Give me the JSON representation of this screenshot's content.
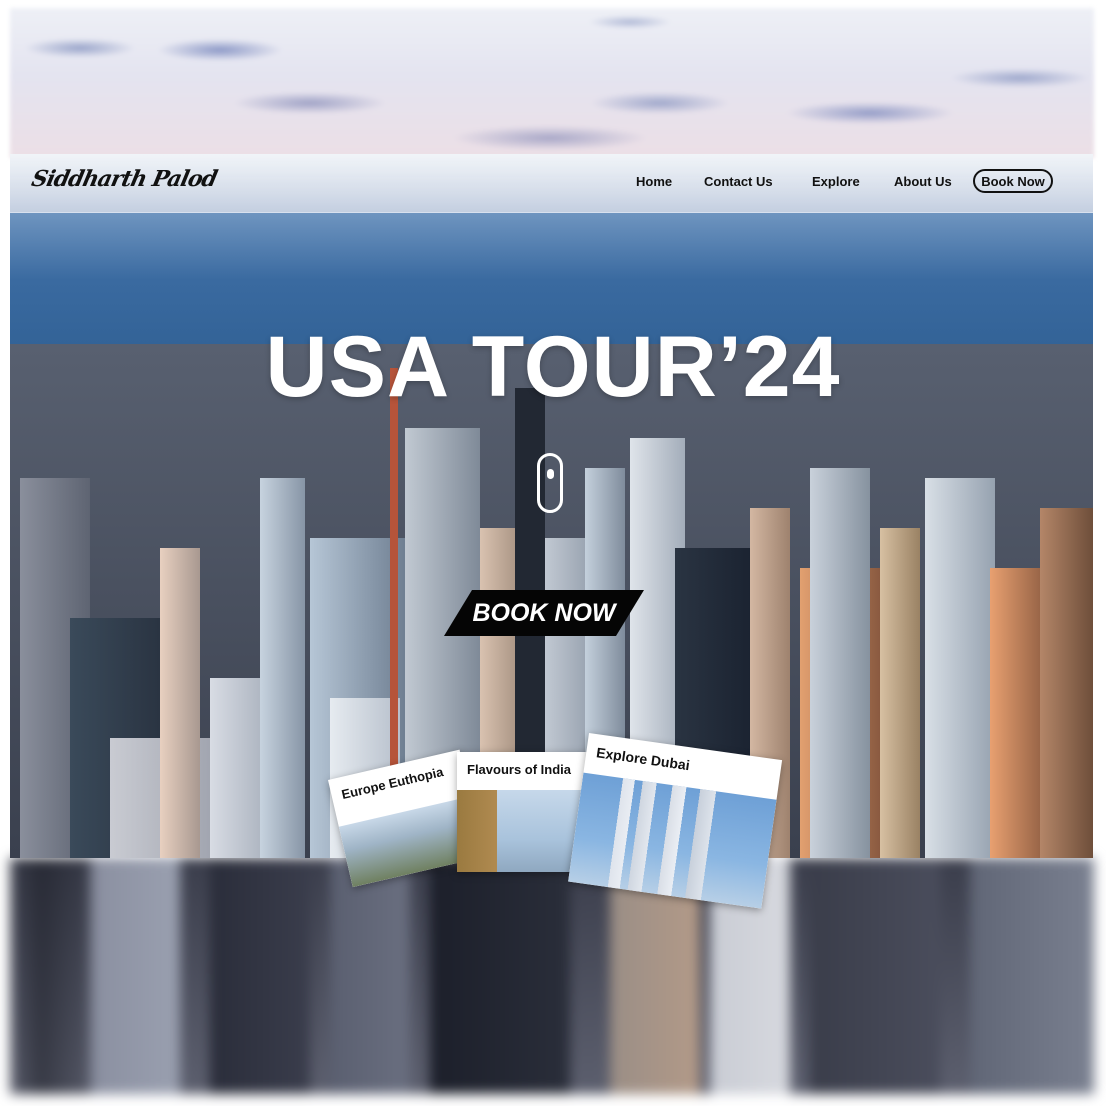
{
  "brand": {
    "logo_text": "Siddharth Palod"
  },
  "nav": {
    "items": [
      {
        "label": "Home"
      },
      {
        "label": "Contact Us"
      },
      {
        "label": "Explore"
      },
      {
        "label": "About Us"
      }
    ],
    "cta_label": "Book Now"
  },
  "hero": {
    "title": "USA TOUR’24",
    "cta_label": "BOOK NOW",
    "scroll_icon": "mouse-scroll-icon"
  },
  "cards": [
    {
      "label": "Europe Euthopia"
    },
    {
      "label": "Flavours of India"
    },
    {
      "label": "Explore Dubai",
      "icon": "burj-al-arab-icon"
    }
  ],
  "colors": {
    "nav_text": "#111111",
    "hero_title": "#ffffff",
    "cta_bg": "#050505",
    "cta_text": "#ffffff"
  }
}
